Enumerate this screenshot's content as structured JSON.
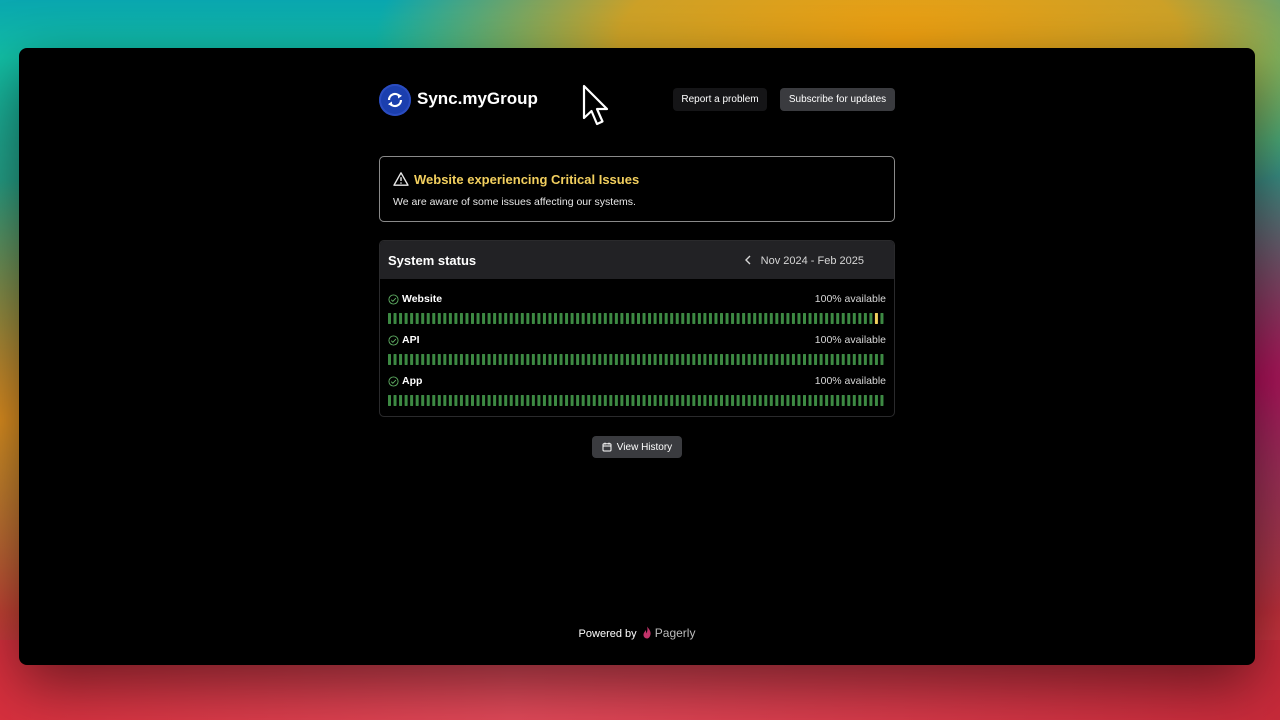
{
  "header": {
    "brand": "Sync.myGroup",
    "report_label": "Report a problem",
    "subscribe_label": "Subscribe for updates"
  },
  "alert": {
    "title": "Website experiencing Critical Issues",
    "body": "We are aware of some issues affecting our systems.",
    "color": "#f2cf5e",
    "icon": "warning-icon"
  },
  "status": {
    "title": "System status",
    "range": "Nov 2024 - Feb 2025",
    "services": [
      {
        "name": "Website",
        "availability": "100% available",
        "days": 90,
        "incident_day": 88
      },
      {
        "name": "API",
        "availability": "100% available",
        "days": 90
      },
      {
        "name": "App",
        "availability": "100% available",
        "days": 90
      }
    ],
    "ok_color": "#3d8a43",
    "incident_color": "#f2cf5e"
  },
  "history": {
    "label": "View History",
    "icon": "calendar-icon"
  },
  "footer": {
    "powered_by": "Powered by",
    "provider": "Pagerly"
  }
}
